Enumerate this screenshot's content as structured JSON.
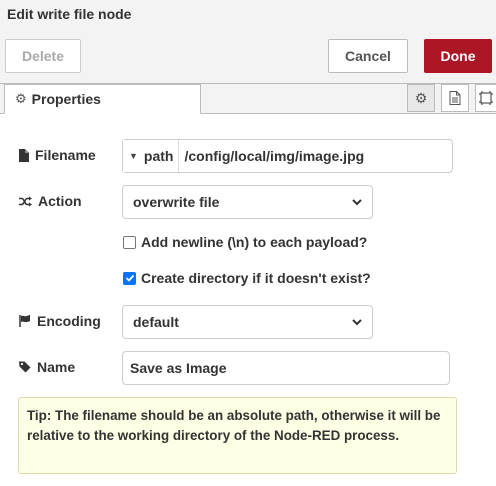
{
  "dialog": {
    "title": "Edit write file node"
  },
  "buttons": {
    "delete": "Delete",
    "cancel": "Cancel",
    "done": "Done"
  },
  "tabs": {
    "properties": "Properties"
  },
  "form": {
    "filename": {
      "label": "Filename",
      "type": "path",
      "value": "/config/local/img/image.jpg"
    },
    "action": {
      "label": "Action",
      "selected": "overwrite file"
    },
    "add_newline": {
      "label": "Add newline (\\n) to each payload?",
      "checked": false
    },
    "create_directory": {
      "label": "Create directory if it doesn't exist?",
      "checked": true
    },
    "encoding": {
      "label": "Encoding",
      "selected": "default"
    },
    "name": {
      "label": "Name",
      "value": "Save as Image"
    }
  },
  "tip": "Tip: The filename should be an absolute path, otherwise it will be relative to the working directory of the Node-RED process.",
  "colors": {
    "done": "#ad1625",
    "tip_bg": "#ffffe6",
    "checkbox": "#0075ff"
  },
  "icons": [
    "gear-icon",
    "file-icon",
    "shuffle-icon",
    "flag-icon",
    "tag-icon",
    "document-icon",
    "frame-icon",
    "chevron-down-icon",
    "caret-down-icon"
  ]
}
